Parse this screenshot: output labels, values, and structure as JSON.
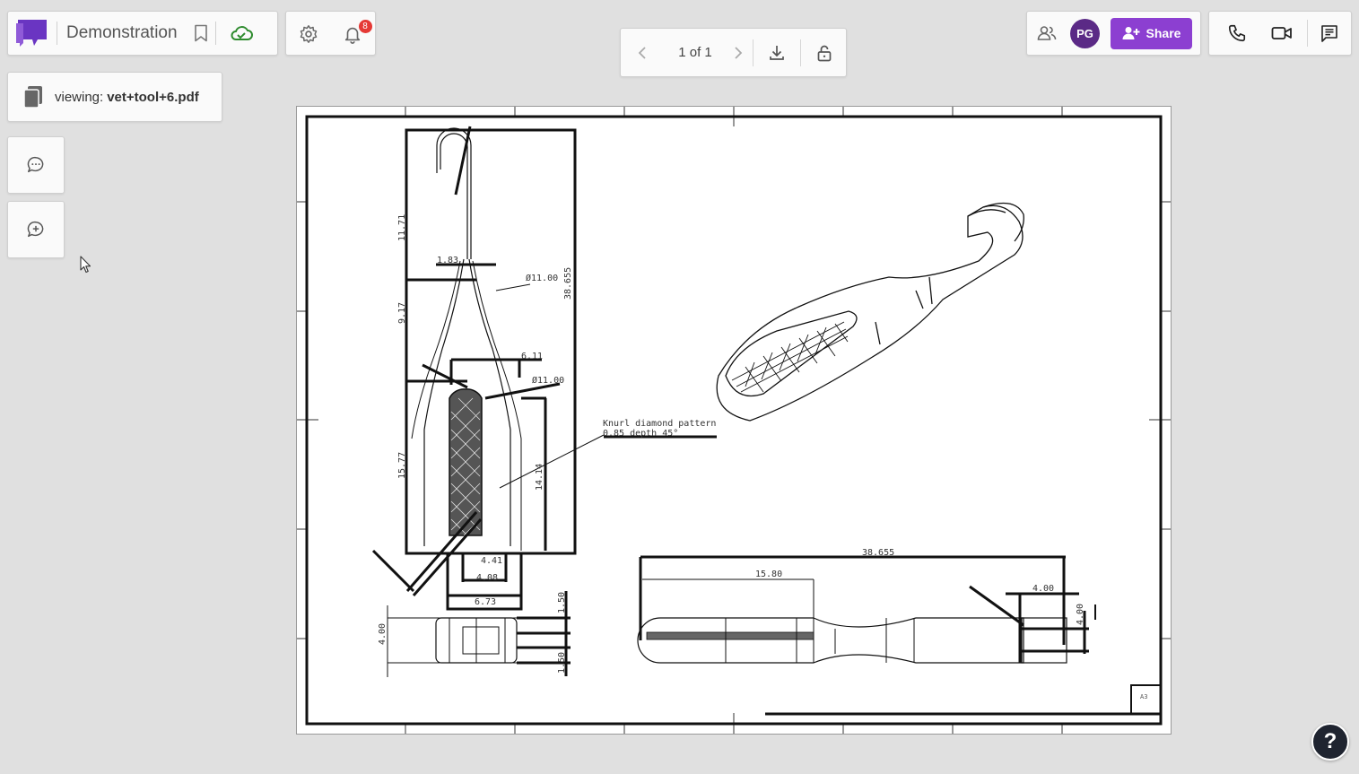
{
  "header": {
    "doc_title": "Demonstration",
    "notification_count": "8"
  },
  "pager": {
    "page_label": "1 of 1"
  },
  "collab": {
    "avatar_initials": "PG",
    "share_label": "Share"
  },
  "viewing": {
    "prefix": "viewing:",
    "filename": "vet+tool+6.pdf"
  },
  "drawing": {
    "note_line1": "Knurl diamond pattern",
    "note_line2": "0.85 depth 45°",
    "dims": {
      "overall_length": "38.655",
      "knurl_length": "15.80",
      "hook_depth": "4.00",
      "top_height": "11.71",
      "mid_height": "9.17",
      "lower_height": "15.77",
      "right_height": "38.655",
      "neck_width": "1.83",
      "diam_a": "Ø11.00",
      "width_a": "6.11",
      "diam_b": "Ø11.00",
      "side_height": "14.14",
      "w_441": "4.41",
      "w_408": "4.08",
      "w_673": "6.73",
      "end_height": "4.00",
      "end_a": "1.50",
      "end_b": "1.50",
      "right_end": "4.00"
    },
    "sheet_label": "A3"
  },
  "icons": {
    "logo": "chat-logo-icon",
    "bookmark": "bookmark-icon",
    "cloud": "cloud-check-icon",
    "settings": "gear-icon",
    "notifications": "bell-icon",
    "prev": "chevron-left-icon",
    "next": "chevron-right-icon",
    "download": "download-icon",
    "lock": "unlock-icon",
    "users": "users-icon",
    "share": "user-plus-icon",
    "phone": "phone-icon",
    "video": "video-icon",
    "comments": "comments-list-icon",
    "comment": "comment-icon",
    "add_comment": "add-comment-icon",
    "file": "file-stack-icon",
    "help": "help-icon"
  },
  "colors": {
    "brand": "#6a35c2",
    "share_button": "#8c3fd1",
    "avatar": "#5b2a86",
    "badge": "#e53935",
    "cloud_ok": "#2e8b2e",
    "help_bg": "#1f2430"
  }
}
